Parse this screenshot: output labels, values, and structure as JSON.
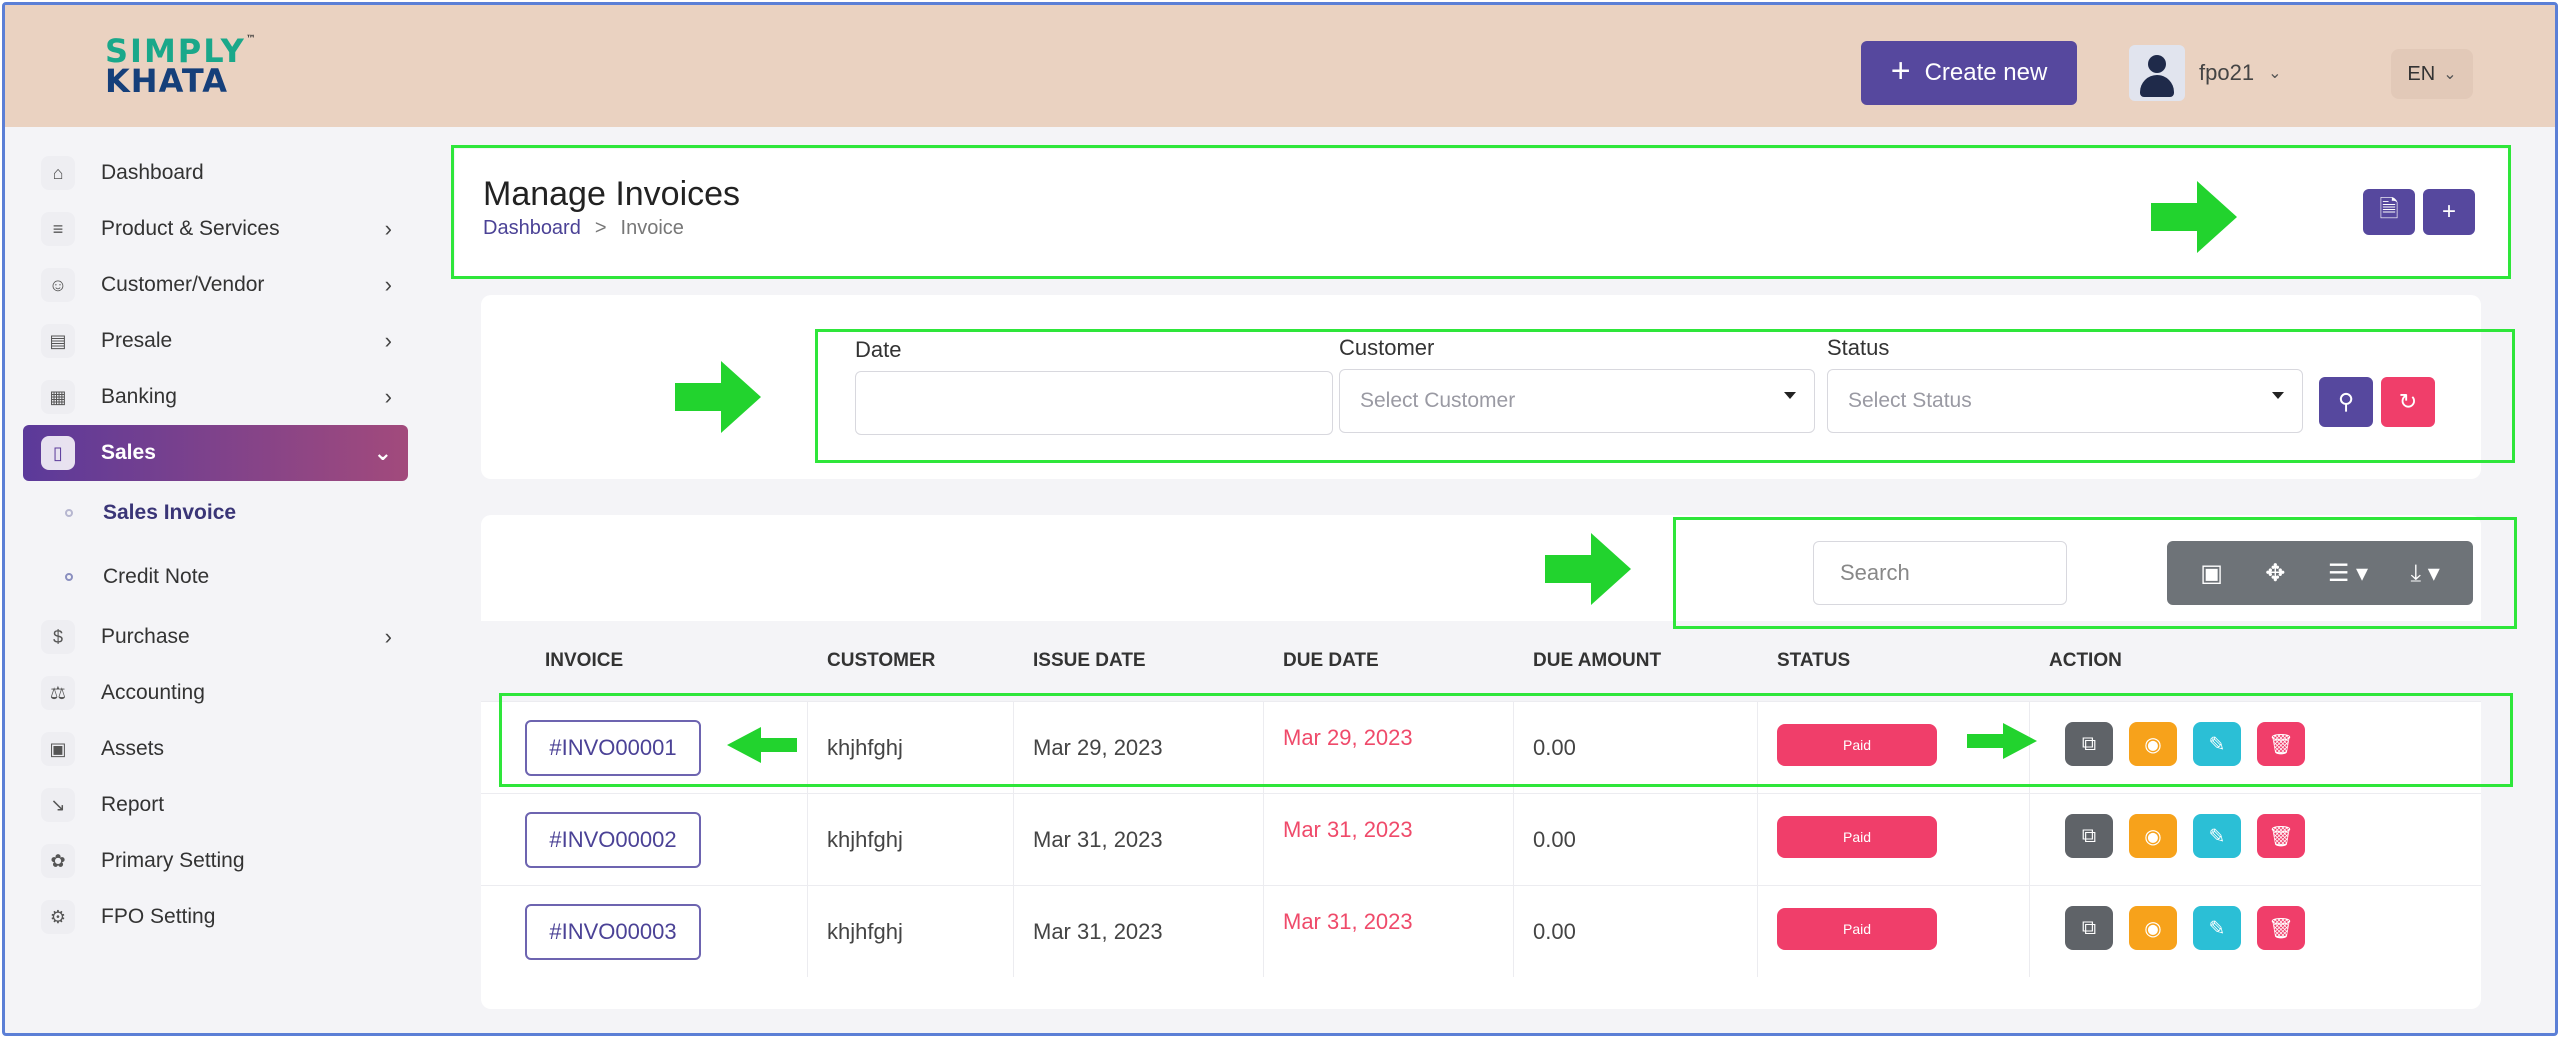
{
  "app": {
    "logo_top": "SIMPLY",
    "logo_bottom": "KHATA",
    "logo_tm": "™"
  },
  "header": {
    "create_new": "Create new",
    "user_name": "fpo21",
    "language": "EN"
  },
  "sidebar": {
    "items": [
      {
        "label": "Dashboard",
        "icon": "home-icon",
        "has_arrow": false
      },
      {
        "label": "Product & Services",
        "icon": "cart-icon",
        "has_arrow": true
      },
      {
        "label": "Customer/Vendor",
        "icon": "user-plus-icon",
        "has_arrow": true
      },
      {
        "label": "Presale",
        "icon": "folder-icon",
        "has_arrow": true
      },
      {
        "label": "Banking",
        "icon": "bank-icon",
        "has_arrow": true
      },
      {
        "label": "Sales",
        "icon": "document-icon",
        "has_arrow": true,
        "active": true
      }
    ],
    "sub_items": [
      {
        "label": "Sales Invoice",
        "active": true
      },
      {
        "label": "Credit Note",
        "active": false
      }
    ],
    "items_after": [
      {
        "label": "Purchase",
        "icon": "purchase-icon",
        "has_arrow": true
      },
      {
        "label": "Accounting",
        "icon": "scale-icon",
        "has_arrow": false
      },
      {
        "label": "Assets",
        "icon": "assets-icon",
        "has_arrow": false
      },
      {
        "label": "Report",
        "icon": "chart-icon",
        "has_arrow": false
      },
      {
        "label": "Primary Setting",
        "icon": "settings-icon",
        "has_arrow": false
      },
      {
        "label": "FPO Setting",
        "icon": "gear-icon",
        "has_arrow": false
      }
    ]
  },
  "page": {
    "title": "Manage Invoices",
    "breadcrumb_home": "Dashboard",
    "breadcrumb_sep": ">",
    "breadcrumb_current": "Invoice"
  },
  "filters": {
    "date_label": "Date",
    "date_value": "",
    "customer_label": "Customer",
    "customer_placeholder": "Select Customer",
    "status_label": "Status",
    "status_placeholder": "Select Status"
  },
  "table": {
    "search_placeholder": "Search",
    "columns": [
      "INVOICE",
      "CUSTOMER",
      "ISSUE DATE",
      "DUE DATE",
      "DUE AMOUNT",
      "STATUS",
      "ACTION"
    ],
    "rows": [
      {
        "invoice": "#INVO00001",
        "customer": "khjhfghj",
        "issue_date": "Mar 29, 2023",
        "due_date": "Mar 29, 2023",
        "due_amount": "0.00",
        "status": "Paid"
      },
      {
        "invoice": "#INVO00002",
        "customer": "khjhfghj",
        "issue_date": "Mar 31, 2023",
        "due_date": "Mar 31, 2023",
        "due_amount": "0.00",
        "status": "Paid"
      },
      {
        "invoice": "#INVO00003",
        "customer": "khjhfghj",
        "issue_date": "Mar 31, 2023",
        "due_date": "Mar 31, 2023",
        "due_amount": "0.00",
        "status": "Paid"
      }
    ]
  },
  "colors": {
    "header_bg": "#ead2c1",
    "primary": "#56489e",
    "danger": "#f03e6a",
    "highlight": "#2ee63a",
    "action_copy": "#5f6368",
    "action_view": "#f7a21b",
    "action_edit": "#2bbfd6",
    "action_delete": "#f03e6a"
  }
}
